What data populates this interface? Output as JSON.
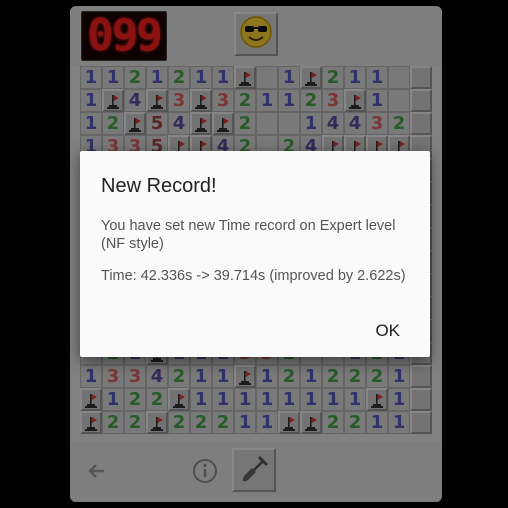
{
  "counter": {
    "value": "099"
  },
  "toolbar": {
    "smiley_icon": "cool-smiley-icon"
  },
  "board": {
    "rows": [
      [
        "1",
        "1",
        "2",
        "1",
        "2",
        "1",
        "1",
        "F",
        "",
        "1",
        "F",
        "2",
        "1",
        "1",
        "",
        ""
      ],
      [
        "1",
        "F",
        "4",
        "F",
        "3",
        "F",
        "3",
        "2",
        "1",
        "1",
        "2",
        "3",
        "F",
        "1",
        "",
        ""
      ],
      [
        "1",
        "2",
        "F",
        "5",
        "4",
        "F",
        "F",
        "2",
        "",
        "",
        "1",
        "4",
        "4",
        "3",
        "2",
        ""
      ],
      [
        "1",
        "3",
        "3",
        "5",
        "F",
        "F",
        "4",
        "2",
        "",
        "2",
        "4",
        "F",
        "F",
        "F",
        "F",
        ""
      ],
      [
        "",
        "",
        "",
        "",
        "",
        "",
        "",
        "",
        "",
        "",
        "",
        "",
        "",
        "",
        "",
        ""
      ],
      [
        "",
        "",
        "",
        "",
        "",
        "",
        "",
        "",
        "",
        "",
        "",
        "",
        "",
        "",
        "",
        ""
      ],
      [
        "",
        "",
        "",
        "",
        "",
        "",
        "",
        "",
        "",
        "",
        "",
        "",
        "",
        "",
        "",
        ""
      ],
      [
        "",
        "",
        "",
        "",
        "",
        "",
        "",
        "",
        "",
        "",
        "",
        "",
        "",
        "",
        "",
        ""
      ],
      [
        "",
        "",
        "",
        "",
        "",
        "",
        "",
        "",
        "",
        "",
        "",
        "",
        "",
        "",
        "",
        ""
      ],
      [
        "",
        "",
        "",
        "",
        "",
        "",
        "",
        "",
        "",
        "",
        "",
        "",
        "",
        "",
        "",
        ""
      ],
      [
        "",
        "",
        "",
        "",
        "",
        "",
        "",
        "",
        "",
        "",
        "",
        "",
        "",
        "",
        "",
        ""
      ],
      [
        "",
        "",
        "",
        "",
        "",
        "",
        "",
        "",
        "",
        "",
        "",
        "",
        "",
        "",
        "",
        ""
      ],
      [
        "",
        "2",
        "1",
        "F",
        "1",
        "1",
        "1",
        "3",
        "3",
        "2",
        "",
        "",
        "1",
        "2",
        "1",
        ""
      ],
      [
        "1",
        "3",
        "3",
        "4",
        "2",
        "1",
        "1",
        "F",
        "1",
        "2",
        "1",
        "2",
        "2",
        "2",
        "1",
        ""
      ],
      [
        "F",
        "1",
        "2",
        "2",
        "F",
        "1",
        "1",
        "1",
        "1",
        "1",
        "1",
        "1",
        "1",
        "F",
        "1",
        ""
      ],
      [
        "F",
        "2",
        "2",
        "F",
        "2",
        "2",
        "2",
        "1",
        "1",
        "F",
        "F",
        "2",
        "2",
        "1",
        "1",
        ""
      ]
    ]
  },
  "bottom": {
    "back_icon": "back-arrow-icon",
    "info_icon": "info-icon",
    "shovel_icon": "shovel-icon"
  },
  "dialog": {
    "title": "New Record!",
    "message": "You have set new Time record on Expert level (NF style)",
    "stats": "Time: 42.336s -> 39.714s (improved by 2.622s)",
    "ok_label": "OK"
  },
  "colors": {
    "n1": "#5a5cc0",
    "n2": "#49a74c",
    "n3": "#e16565",
    "n4": "#5b4fa3",
    "n5": "#a34545",
    "counter": "#ff2222",
    "dialog_bg": "#fafafa"
  }
}
